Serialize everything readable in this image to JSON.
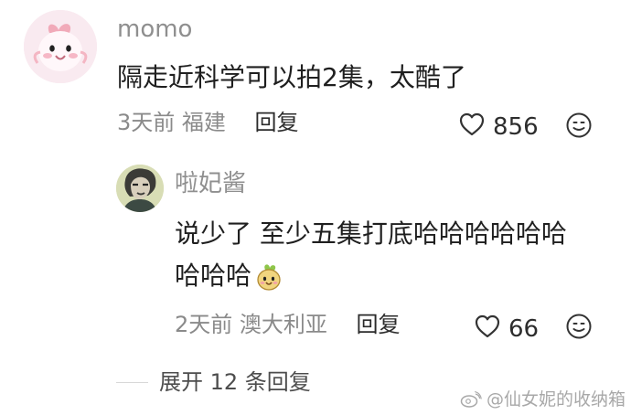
{
  "comment": {
    "username": "momo",
    "text": "隔走近科学可以拍2集，太酷了",
    "meta": "3天前 福建",
    "reply_label": "回复",
    "like_count": "856"
  },
  "reply": {
    "username": "啦妃酱",
    "text_line1": "说少了 至少五集打底哈哈哈哈哈哈",
    "text_line2": "哈哈哈",
    "meta": "2天前 澳大利亚",
    "reply_label": "回复",
    "like_count": "66"
  },
  "expand": {
    "label": "展开 12 条回复"
  },
  "watermark": {
    "text": "@仙女妮的收纳箱"
  },
  "icons": {
    "like": "heart-outline-icon",
    "emoji": "smiley-icon",
    "sticker": "cute-sticker-emoji"
  },
  "colors": {
    "username": "#8f8f8f",
    "body_text": "#1f1f1f",
    "meta": "#8a8a8a",
    "reply_link": "#2b2b2b"
  }
}
